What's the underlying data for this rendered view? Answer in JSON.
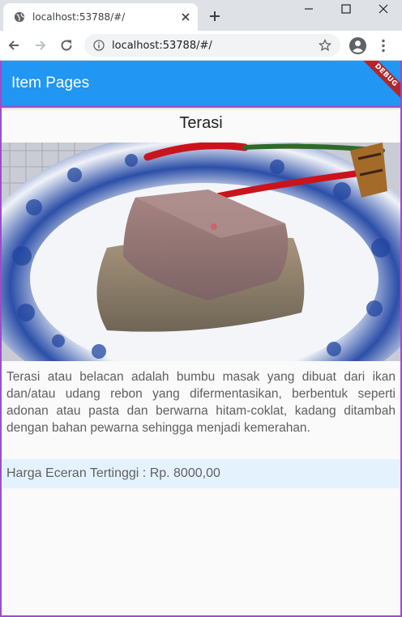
{
  "browser": {
    "tab_title": "localhost:53788/#/",
    "url": "localhost:53788/#/"
  },
  "appbar": {
    "title": "Item Pages",
    "debug_label": "DEBUG",
    "color": "#2196f3"
  },
  "item": {
    "title": "Terasi",
    "image_alt": "terasi-photo",
    "description": "Terasi atau belacan adalah bumbu masak yang dibuat dari ikan dan/atau udang rebon yang difermentasikan, berbentuk seperti adonan atau pasta dan berwarna hitam-coklat, kadang ditambah dengan bahan pewarna sehingga menjadi kemerahan.",
    "price_text": "Harga Eceran Tertinggi :  Rp. 8000,00"
  },
  "icons": {
    "favicon": "globe-icon",
    "tab_close": "close-icon",
    "new_tab": "plus-icon",
    "back": "arrow-left-icon",
    "forward": "arrow-right-icon",
    "reload": "reload-icon",
    "info": "info-icon",
    "star": "star-icon",
    "profile": "account-icon",
    "menu": "more-vert-icon"
  }
}
